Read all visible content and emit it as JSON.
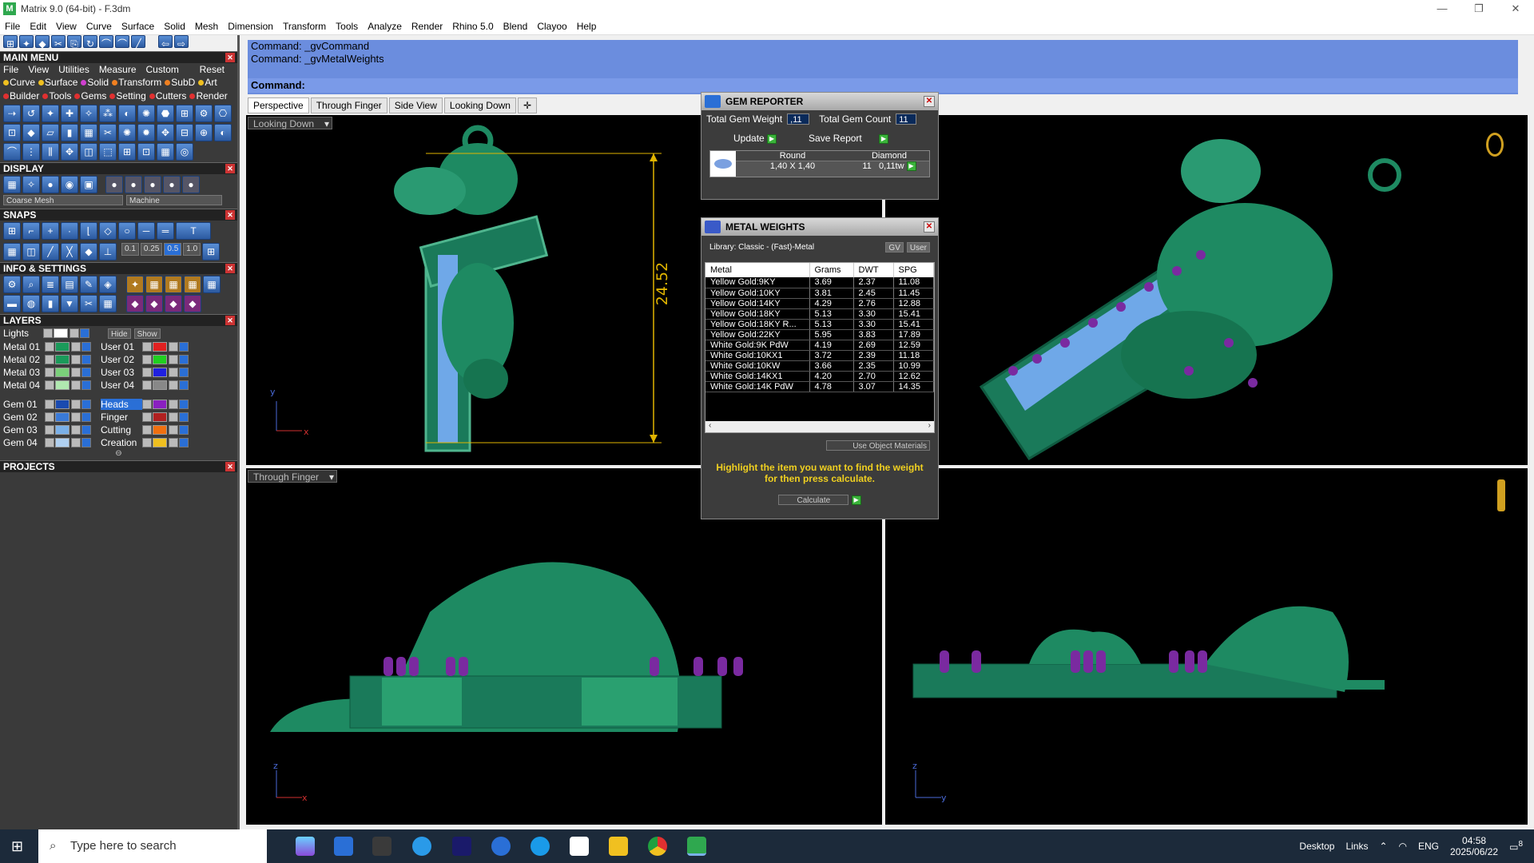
{
  "window": {
    "title": "Matrix 9.0 (64-bit) - F.3dm",
    "controls": [
      "—",
      "❐",
      "✕"
    ]
  },
  "menubar": [
    "File",
    "Edit",
    "View",
    "Curve",
    "Surface",
    "Solid",
    "Mesh",
    "Dimension",
    "Transform",
    "Tools",
    "Analyze",
    "Render",
    "Rhino 5.0",
    "Blend",
    "Clayoo",
    "Help"
  ],
  "left": {
    "main_menu": {
      "title": "MAIN MENU",
      "row1": [
        "File",
        "View",
        "Utilities",
        "Measure",
        "Custom"
      ],
      "reset": "Reset",
      "row2": [
        {
          "label": "Curve",
          "color": "#f0c020"
        },
        {
          "label": "Surface",
          "color": "#f0c020"
        },
        {
          "label": "Solid",
          "color": "#d040d0"
        },
        {
          "label": "Transform",
          "color": "#f08020"
        },
        {
          "label": "SubD",
          "color": "#f08020"
        },
        {
          "label": "Art",
          "color": "#f0c020"
        }
      ],
      "row3": [
        {
          "label": "Builder",
          "color": "#e03030"
        },
        {
          "label": "Tools",
          "color": "#e03030"
        },
        {
          "label": "Gems",
          "color": "#e03030"
        },
        {
          "label": "Setting",
          "color": "#e03030"
        },
        {
          "label": "Cutters",
          "color": "#e03030"
        },
        {
          "label": "Render",
          "color": "#e03030"
        }
      ]
    },
    "display": {
      "title": "DISPLAY",
      "mesh": "Coarse Mesh",
      "machine": "Machine"
    },
    "snaps": {
      "title": "SNAPS",
      "values": [
        "0.1",
        "0.25",
        "0.5",
        "1.0"
      ]
    },
    "info": {
      "title": "INFO & SETTINGS"
    },
    "layers": {
      "title": "LAYERS",
      "lights": "Lights",
      "hide": "Hide",
      "show": "Show",
      "left": [
        {
          "name": "Metal 01",
          "color": "#1a9a5a"
        },
        {
          "name": "Metal 02",
          "color": "#1a9a5a"
        },
        {
          "name": "Metal 03",
          "color": "#7ad07a"
        },
        {
          "name": "Metal 04",
          "color": "#b0e8b0"
        },
        {
          "name": "Gem 01",
          "color": "#1a4ab0"
        },
        {
          "name": "Gem 02",
          "color": "#3a7ad8"
        },
        {
          "name": "Gem 03",
          "color": "#7ab0e8"
        },
        {
          "name": "Gem 04",
          "color": "#b0d0f0"
        }
      ],
      "right": [
        {
          "name": "User 01",
          "color": "#e02020"
        },
        {
          "name": "User 02",
          "color": "#20d020"
        },
        {
          "name": "User 03",
          "color": "#2020e0"
        },
        {
          "name": "User 04",
          "color": "#888888"
        },
        {
          "name": "Heads",
          "color": "#8a20c0"
        },
        {
          "name": "Finger",
          "color": "#b02020"
        },
        {
          "name": "Cutting",
          "color": "#f07010"
        },
        {
          "name": "Creation",
          "color": "#f0c020"
        }
      ]
    },
    "projects": {
      "title": "PROJECTS"
    }
  },
  "command": {
    "lines": [
      "Command: _gvCommand",
      "Command: _gvMetalWeights"
    ],
    "prompt": "Command:"
  },
  "tabs": [
    "Perspective",
    "Through Finger",
    "Side View",
    "Looking Down"
  ],
  "viewports": {
    "top_left": {
      "label": "Looking Down",
      "dimension": "24.52",
      "axis_v": "y",
      "axis_h": "x"
    },
    "bottom_left": {
      "label": "Through Finger",
      "axis_v": "z",
      "axis_h": "x"
    },
    "bottom_right": {
      "axis_v": "z",
      "axis_h": "y"
    }
  },
  "gem_reporter": {
    "title": "GEM REPORTER",
    "total_weight_label": "Total Gem Weight",
    "total_weight": ",11",
    "total_count_label": "Total Gem Count",
    "total_count": "11",
    "update": "Update",
    "save_report": "Save Report",
    "gem": {
      "shape": "Round",
      "size": "1,40 X 1,40",
      "type": "Diamond",
      "count": "11",
      "weight": "0,11tw"
    }
  },
  "metal_weights": {
    "title": "METAL WEIGHTS",
    "library": "Library: Classic - (Fast)-Metal",
    "gv": "GV",
    "user": "User",
    "headers": [
      "Metal",
      "Grams",
      "DWT",
      "SPG"
    ],
    "rows": [
      [
        "Yellow Gold:9KY",
        "3.69",
        "2.37",
        "11.08"
      ],
      [
        "Yellow Gold:10KY",
        "3.81",
        "2.45",
        "11.45"
      ],
      [
        "Yellow Gold:14KY",
        "4.29",
        "2.76",
        "12.88"
      ],
      [
        "Yellow Gold:18KY",
        "5.13",
        "3.30",
        "15.41"
      ],
      [
        "Yellow Gold:18KY R...",
        "5.13",
        "3.30",
        "15.41"
      ],
      [
        "Yellow Gold:22KY",
        "5.95",
        "3.83",
        "17.89"
      ],
      [
        "White Gold:9K PdW",
        "4.19",
        "2.69",
        "12.59"
      ],
      [
        "White Gold:10KX1",
        "3.72",
        "2.39",
        "11.18"
      ],
      [
        "White Gold:10KW",
        "3.66",
        "2.35",
        "10.99"
      ],
      [
        "White Gold:14KX1",
        "4.20",
        "2.70",
        "12.62"
      ],
      [
        "White Gold:14K PdW",
        "4.78",
        "3.07",
        "14.35"
      ]
    ],
    "use_object_materials": "Use Object Materials",
    "hint": "Highlight the item you want to find the weight for then press calculate.",
    "calculate": "Calculate"
  },
  "taskbar": {
    "search_placeholder": "Type here to search",
    "desktop": "Desktop",
    "links": "Links",
    "lang": "ENG",
    "time": "04:58",
    "date": "2025/06/22",
    "notif": "8"
  }
}
